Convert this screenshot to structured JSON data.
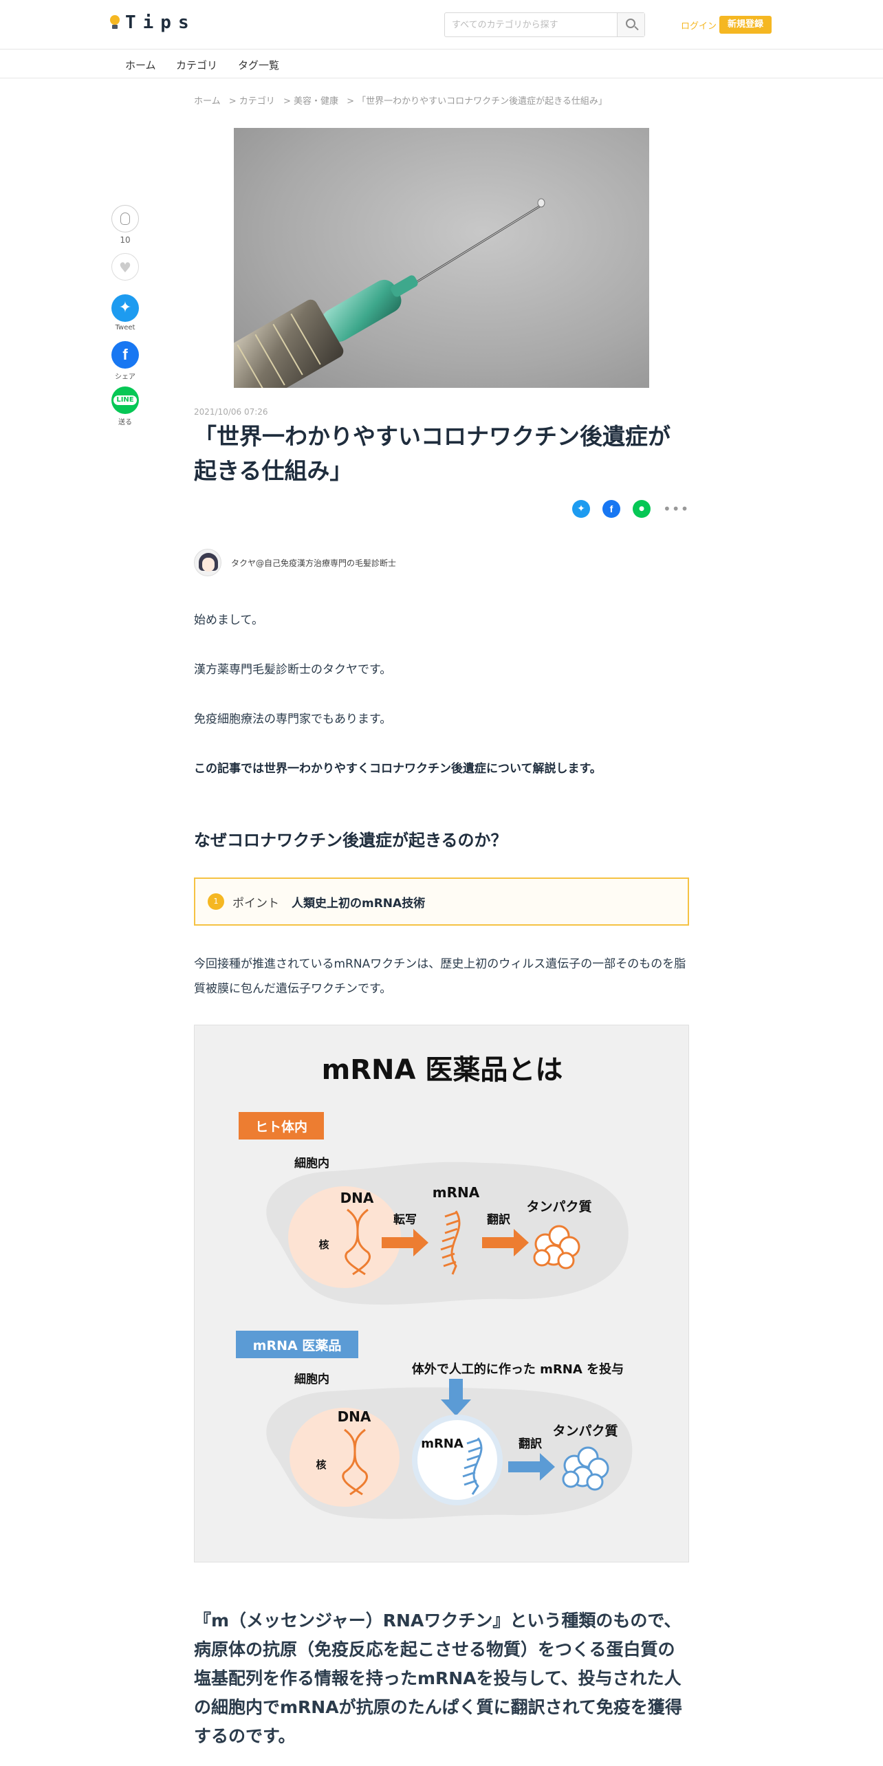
{
  "header": {
    "logo_text": "Tips",
    "search_placeholder": "すべてのカテゴリから探す",
    "login": "ログイン",
    "signup": "新規登録"
  },
  "nav": {
    "items": [
      "ホーム",
      "カテゴリ",
      "タグ一覧"
    ]
  },
  "breadcrumb": [
    "ホーム",
    "> カテゴリ",
    "> 美容・健康",
    "> 「世界一わかりやすいコロナワクチン後遺症が起きる仕組み」"
  ],
  "sidebar": {
    "clap_count": "10",
    "tweet": "Tweet",
    "share": "シェア",
    "send": "送る",
    "line_icon": "LINE"
  },
  "article": {
    "date": "2021/10/06 07:26",
    "title": "「世界一わかりやすいコロナワクチン後遺症が起きる仕組み」",
    "author": "タクヤ@自己免疫漢方治療専門の毛髪診断士",
    "p1": "始めまして。",
    "p2": "漢方薬専門毛髪診断士のタクヤです。",
    "p3": "免疫細胞療法の専門家でもあります。",
    "p4": "この記事では世界一わかりやすくコロナワクチン後遺症について解説します。",
    "h2": "なぜコロナワクチン後遺症が起きるのか？",
    "point_num": "1",
    "point_label": "ポイント",
    "point_text": "人類史上初のmRNA技術",
    "p5": "今回接種が推進されているmRNAワクチンは、歴史上初のウィルス遺伝子の一部そのものを脂質被膜に包んだ遺伝子ワクチンです。",
    "p6": "『m（メッセンジャー）RNAワクチン』という種類のもので、病原体の抗原（免疫反応を起こさせる物質）をつくる蛋白質の塩基配列を作る情報を持ったmRNAを投与して、投与された人の細胞内でmRNAが抗原のたんぱく質に翻訳されて免疫を獲得するのです。"
  },
  "figure": {
    "title": "mRNA 医薬品とは",
    "tag1": "ヒト体内",
    "tag2": "mRNA 医薬品",
    "cell": "細胞内",
    "dna": "DNA",
    "nucleus": "核",
    "transcription": "転写",
    "mrna": "mRNA",
    "translation": "翻訳",
    "protein": "タンパク質",
    "inject": "体外で人工的に作った mRNA を投与",
    "colors": {
      "orange": "#ed7d31",
      "blue": "#5b9bd5",
      "nucleus": "#fde3d3"
    }
  }
}
